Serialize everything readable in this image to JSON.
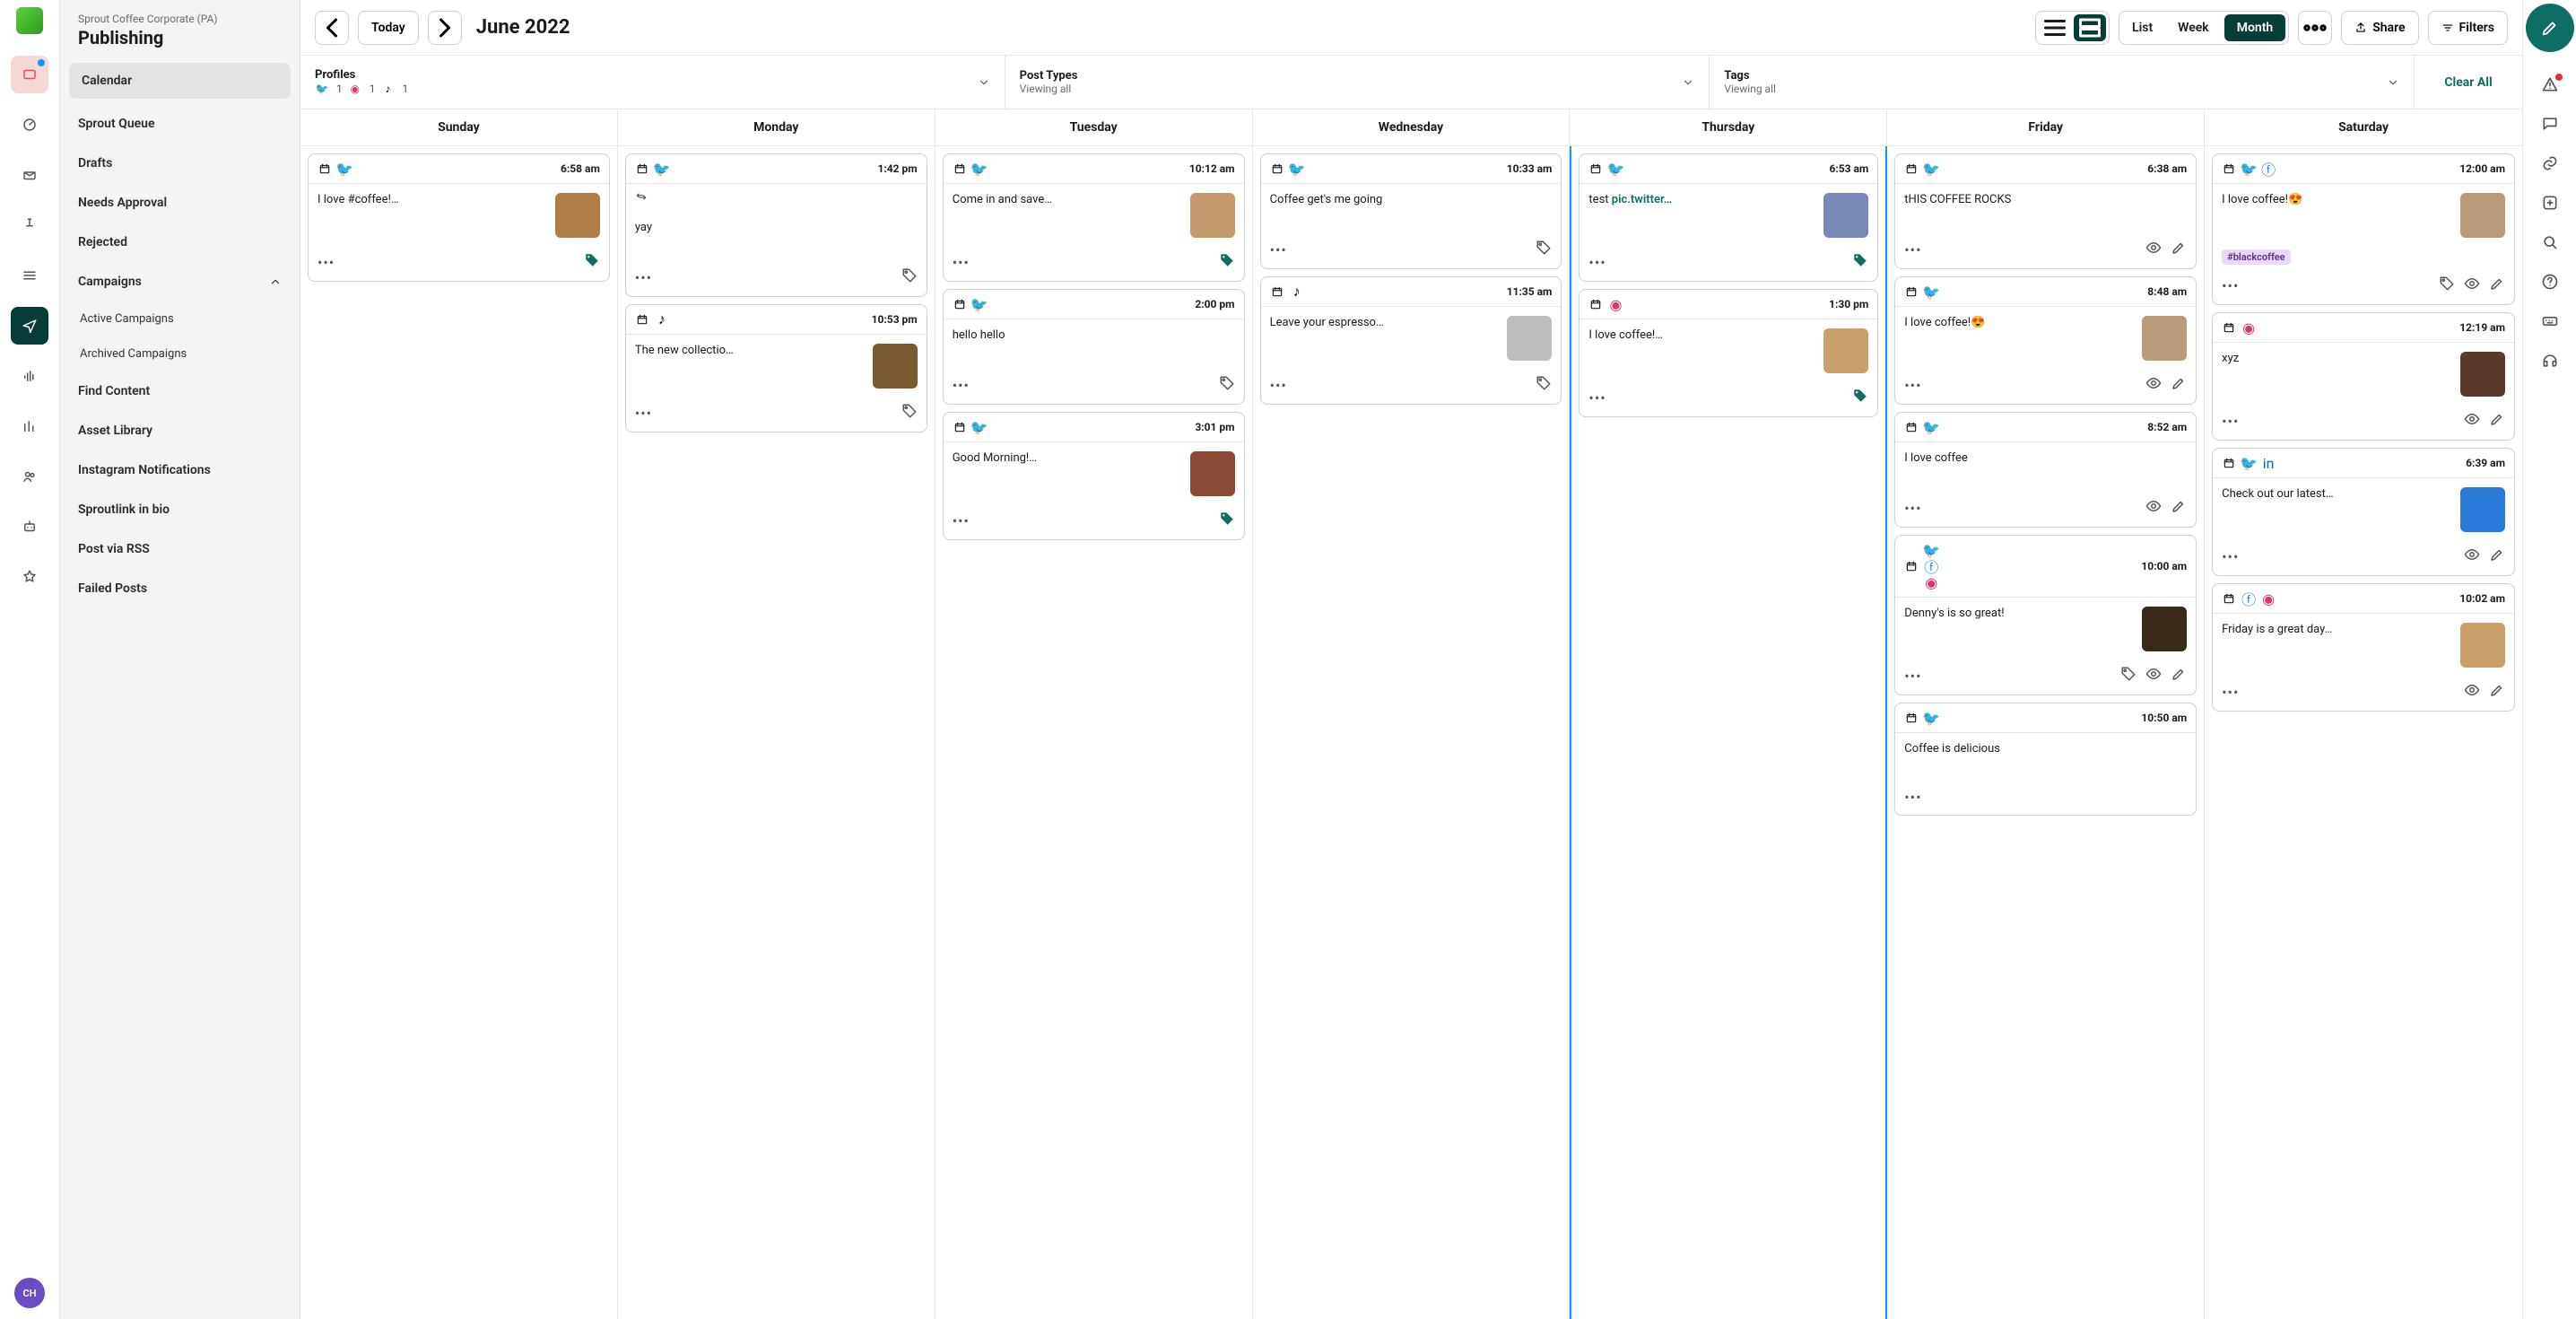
{
  "org": "Sprout Coffee Corporate (PA)",
  "section": "Publishing",
  "avatar_initials": "CH",
  "nav": {
    "calendar": "Calendar",
    "queue": "Sprout Queue",
    "drafts": "Drafts",
    "needs_approval": "Needs Approval",
    "rejected": "Rejected",
    "campaigns": "Campaigns",
    "active_campaigns": "Active Campaigns",
    "archived_campaigns": "Archived Campaigns",
    "find_content": "Find Content",
    "asset_library": "Asset Library",
    "instagram_notifications": "Instagram Notifications",
    "sproutlink": "Sproutlink in bio",
    "post_rss": "Post via RSS",
    "failed_posts": "Failed Posts"
  },
  "toolbar": {
    "today": "Today",
    "month_label": "June 2022",
    "list": "List",
    "week": "Week",
    "month": "Month",
    "share": "Share",
    "filters": "Filters"
  },
  "filters": {
    "profiles": {
      "label": "Profiles",
      "tw": "1",
      "ig": "1",
      "tk": "1"
    },
    "post_types": {
      "label": "Post Types",
      "sub": "Viewing all"
    },
    "tags": {
      "label": "Tags",
      "sub": "Viewing all"
    },
    "clear_all": "Clear All"
  },
  "days": [
    "Sunday",
    "Monday",
    "Tuesday",
    "Wednesday",
    "Thursday",
    "Friday",
    "Saturday"
  ],
  "posts": {
    "sun": [
      {
        "icons": [
          "cal",
          "tw"
        ],
        "time": "6:58 am",
        "text": "I love #coffee!…",
        "thumb": "#b07d46",
        "tag": true
      }
    ],
    "mon": [
      {
        "icons": [
          "cal",
          "tw"
        ],
        "time": "1:42 pm",
        "retweet": true,
        "text": "yay",
        "tagoutline": true
      },
      {
        "icons": [
          "cal",
          "tk"
        ],
        "time": "10:53 pm",
        "text": "The new collectio…",
        "thumb": "#7a5a2e",
        "tagoutline": true
      }
    ],
    "tue": [
      {
        "icons": [
          "cal",
          "tw"
        ],
        "time": "10:12 am",
        "text": "Come in and save…",
        "thumb": "#c49a6c",
        "tag": true
      },
      {
        "icons": [
          "cal",
          "tw"
        ],
        "time": "2:00 pm",
        "text": "hello hello",
        "tagoutline": true
      },
      {
        "icons": [
          "cal",
          "tw"
        ],
        "time": "3:01 pm",
        "text": "Good Morning!…",
        "thumb": "#8a4a36",
        "tag": true
      }
    ],
    "wed": [
      {
        "icons": [
          "cal",
          "tw"
        ],
        "time": "10:33 am",
        "text": "Coffee get's me going",
        "tagoutline": true
      },
      {
        "icons": [
          "cal",
          "tk"
        ],
        "time": "11:35 am",
        "text": "Leave your espresso…",
        "thumb": "#bdbdbd",
        "tagoutline": true
      }
    ],
    "thu": [
      {
        "icons": [
          "cal",
          "tw"
        ],
        "time": "6:53 am",
        "text": "test ",
        "link": "pic.twitter…",
        "thumb": "#7a89b8",
        "tag": true
      },
      {
        "icons": [
          "cal",
          "ig"
        ],
        "time": "1:30 pm",
        "text": "I love coffee!…",
        "thumb": "#caa06a",
        "tag": true
      }
    ],
    "fri": [
      {
        "icons": [
          "cal",
          "tw"
        ],
        "time": "6:38 am",
        "text": "tHIS COFFEE ROCKS",
        "eye": true,
        "edit": true
      },
      {
        "icons": [
          "cal",
          "tw"
        ],
        "time": "8:48 am",
        "text": "I love coffee!😍",
        "thumb": "#b89b7a",
        "eye": true,
        "edit": true
      },
      {
        "icons": [
          "cal",
          "tw"
        ],
        "time": "8:52 am",
        "text": "I love coffee",
        "eye": true,
        "edit": true
      },
      {
        "icons": [
          "cal",
          "tw",
          "fb",
          "ig"
        ],
        "time": "10:00 am",
        "stacked": true,
        "text": "Denny's is so great!",
        "thumb": "#3a2a1a",
        "tagoutline": true,
        "eye": true,
        "edit": true
      },
      {
        "icons": [
          "cal",
          "tw"
        ],
        "time": "10:50 am",
        "text": "Coffee is delicious"
      }
    ],
    "sat": [
      {
        "icons": [
          "cal",
          "tw",
          "fb"
        ],
        "time": "12:00 am",
        "text": "I love coffee!😍",
        "thumb": "#b89b7a",
        "badge": "#blackcoffee",
        "tagoutline": true,
        "eye": true,
        "edit": true
      },
      {
        "icons": [
          "cal",
          "ig"
        ],
        "time": "12:19 am",
        "text": "xyz",
        "thumb": "#5a3a2a",
        "eye": true,
        "edit": true
      },
      {
        "icons": [
          "cal",
          "tw",
          "li"
        ],
        "time": "6:39 am",
        "text": "Check out our latest…",
        "thumb": "#2a7bd9",
        "eye": true,
        "edit": true
      },
      {
        "icons": [
          "cal",
          "fb",
          "ig"
        ],
        "time": "10:02 am",
        "text": "Friday is a great day…",
        "thumb": "#caa06a",
        "eye": true,
        "edit": true
      }
    ]
  }
}
